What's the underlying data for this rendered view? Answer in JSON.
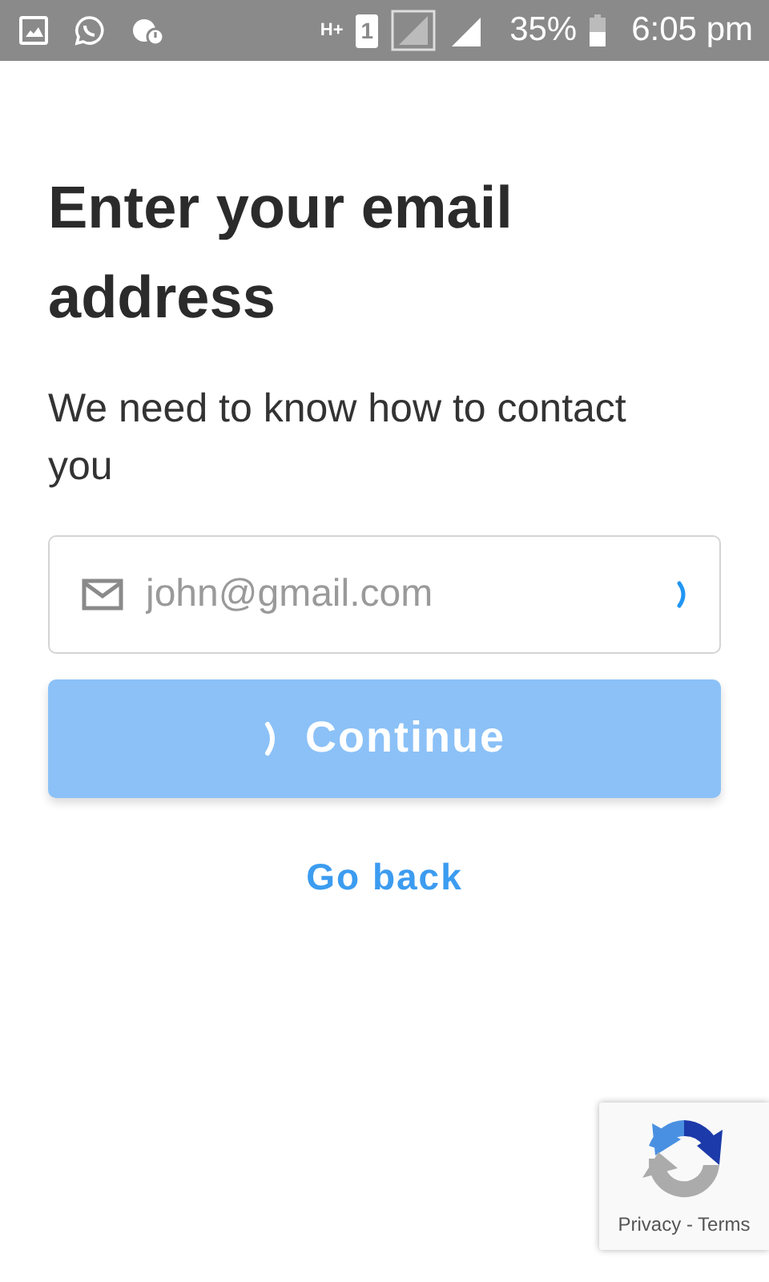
{
  "status_bar": {
    "network_type": "H+",
    "sim": "1",
    "battery": "35%",
    "time": "6:05 pm"
  },
  "title": "Enter your email address",
  "subtitle": "We need to know how to contact you",
  "email_field": {
    "placeholder": "john@gmail.com",
    "loading": true
  },
  "continue_button": {
    "label": "Continue",
    "loading": true,
    "disabled": true
  },
  "back_link": "Go back",
  "recaptcha": {
    "links": "Privacy - Terms"
  }
}
